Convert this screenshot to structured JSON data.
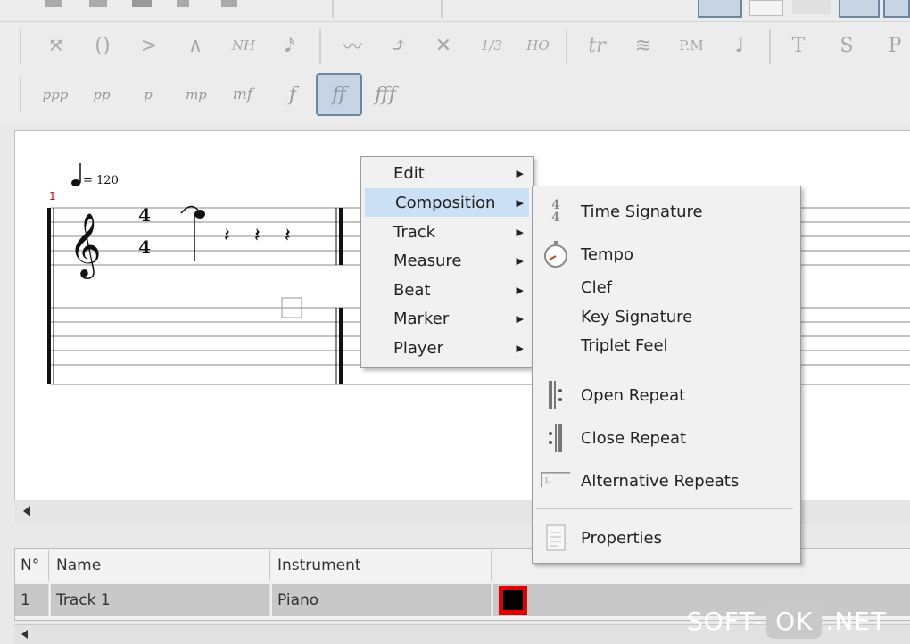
{
  "toolbar": {
    "row2": [
      "⤧",
      "()",
      ">",
      "∧",
      "NH",
      "𝅘𝅥𝅯",
      "〰",
      "⤴",
      "✕",
      "1/3",
      "HO",
      "tr",
      "≋",
      "P.M",
      "♩",
      "T",
      "S",
      "P"
    ],
    "dynamics": [
      "ppp",
      "pp",
      "p",
      "mp",
      "mf",
      "f",
      "ff",
      "fff"
    ],
    "active_dynamic": "ff"
  },
  "score": {
    "measure_number": "1",
    "tempo": "= 120",
    "time_sig_top": "4",
    "time_sig_bottom": "4"
  },
  "context_menu": {
    "items": [
      {
        "label": "Edit"
      },
      {
        "label": "Composition"
      },
      {
        "label": "Track"
      },
      {
        "label": "Measure"
      },
      {
        "label": "Beat"
      },
      {
        "label": "Marker"
      },
      {
        "label": "Player"
      }
    ],
    "highlighted": "Composition"
  },
  "submenu": {
    "time_signature": "Time Signature",
    "tempo": "Tempo",
    "clef": "Clef",
    "key_signature": "Key Signature",
    "triplet_feel": "Triplet Feel",
    "open_repeat": "Open Repeat",
    "close_repeat": "Close Repeat",
    "alternative_repeats": "Alternative Repeats",
    "properties": "Properties"
  },
  "track_table": {
    "headers": {
      "number": "N°",
      "name": "Name",
      "instrument": "Instrument"
    },
    "rows": [
      {
        "number": "1",
        "name": "Track 1",
        "instrument": "Piano",
        "color": "#000000"
      }
    ]
  },
  "watermark": {
    "left": "SOFT-",
    "box": "OK",
    "right": ".NET"
  },
  "colors": {
    "highlight": "#cce0f5",
    "track_color_border": "#e00000",
    "measure_number": "#e00000"
  }
}
